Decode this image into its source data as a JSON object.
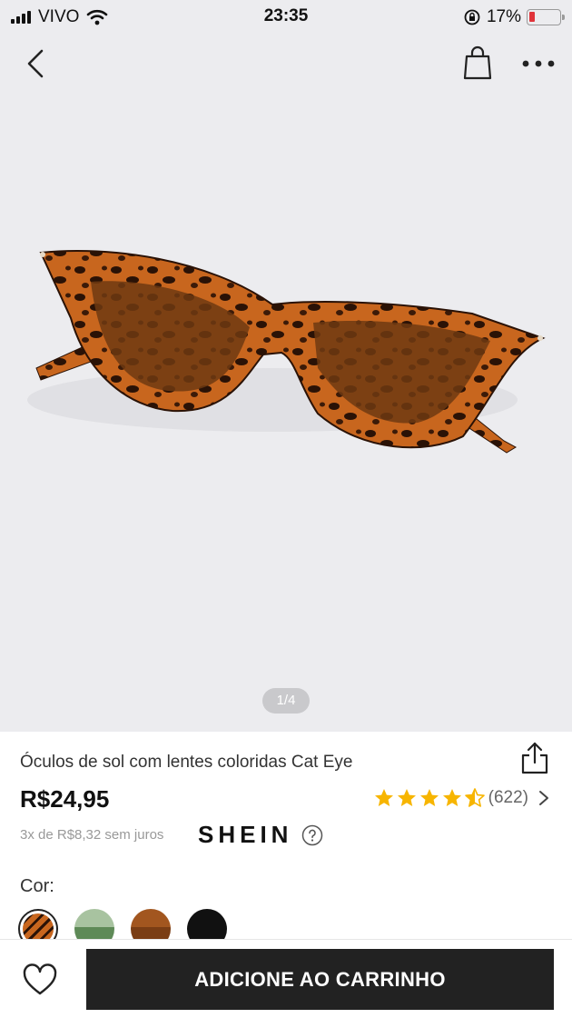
{
  "status_bar": {
    "carrier": "VIVO",
    "time": "23:35",
    "battery": "17%",
    "battery_level": 0.17
  },
  "nav": {
    "back_icon": "chevron-left-icon",
    "bag_icon": "shopping-bag-icon",
    "more_icon": "more-horizontal-icon"
  },
  "gallery": {
    "pager": "1/4"
  },
  "product": {
    "title": "Óculos de sol com lentes coloridas Cat Eye",
    "price": "R$24,95",
    "rating": 4.5,
    "review_count": "(622)",
    "installments": "3x de R$8,32 sem juros",
    "brand": "SHEIN",
    "color_label": "Cor:",
    "swatches": [
      {
        "name": "tortoise",
        "color": "#a0522d",
        "selected": true
      },
      {
        "name": "green",
        "color": "#5e8a57",
        "selected": false
      },
      {
        "name": "brown",
        "color": "#7a3d14",
        "selected": false
      },
      {
        "name": "black",
        "color": "#111111",
        "selected": false
      }
    ]
  },
  "actions": {
    "add_to_cart": "ADICIONE AO CARRINHO"
  },
  "colors": {
    "star": "#f7b500",
    "button_bg": "#222222",
    "hero_bg": "#ececef"
  }
}
